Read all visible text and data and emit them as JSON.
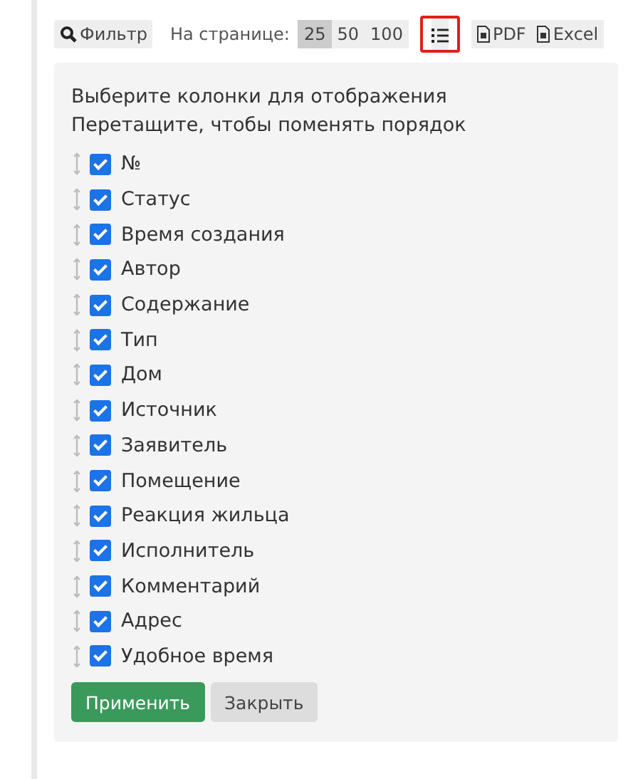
{
  "toolbar": {
    "filter_button": {
      "label": "Фильтр"
    },
    "per_page_label": "На странице:",
    "per_page": [
      {
        "label": "25",
        "selected": true
      },
      {
        "label": "50",
        "selected": false
      },
      {
        "label": "100",
        "selected": false
      }
    ],
    "columns_button": {
      "highlighted": true
    },
    "exports": [
      {
        "label": "PDF"
      },
      {
        "label": "Excel"
      }
    ]
  },
  "panel": {
    "instructions": [
      "Выберите колонки для отображения",
      "Перетащите, чтобы поменять порядок"
    ],
    "columns": [
      {
        "label": "№",
        "checked": true
      },
      {
        "label": "Статус",
        "checked": true
      },
      {
        "label": "Время создания",
        "checked": true
      },
      {
        "label": "Автор",
        "checked": true
      },
      {
        "label": "Содержание",
        "checked": true
      },
      {
        "label": "Тип",
        "checked": true
      },
      {
        "label": "Дом",
        "checked": true
      },
      {
        "label": "Источник",
        "checked": true
      },
      {
        "label": "Заявитель",
        "checked": true
      },
      {
        "label": "Помещение",
        "checked": true
      },
      {
        "label": "Реакция жильца",
        "checked": true
      },
      {
        "label": "Исполнитель",
        "checked": true
      },
      {
        "label": "Комментарий",
        "checked": true
      },
      {
        "label": "Адрес",
        "checked": true
      },
      {
        "label": "Удобное время",
        "checked": true
      }
    ],
    "buttons": [
      {
        "label": "Применить",
        "kind": "primary"
      },
      {
        "label": "Закрыть",
        "kind": "secondary"
      }
    ]
  }
}
